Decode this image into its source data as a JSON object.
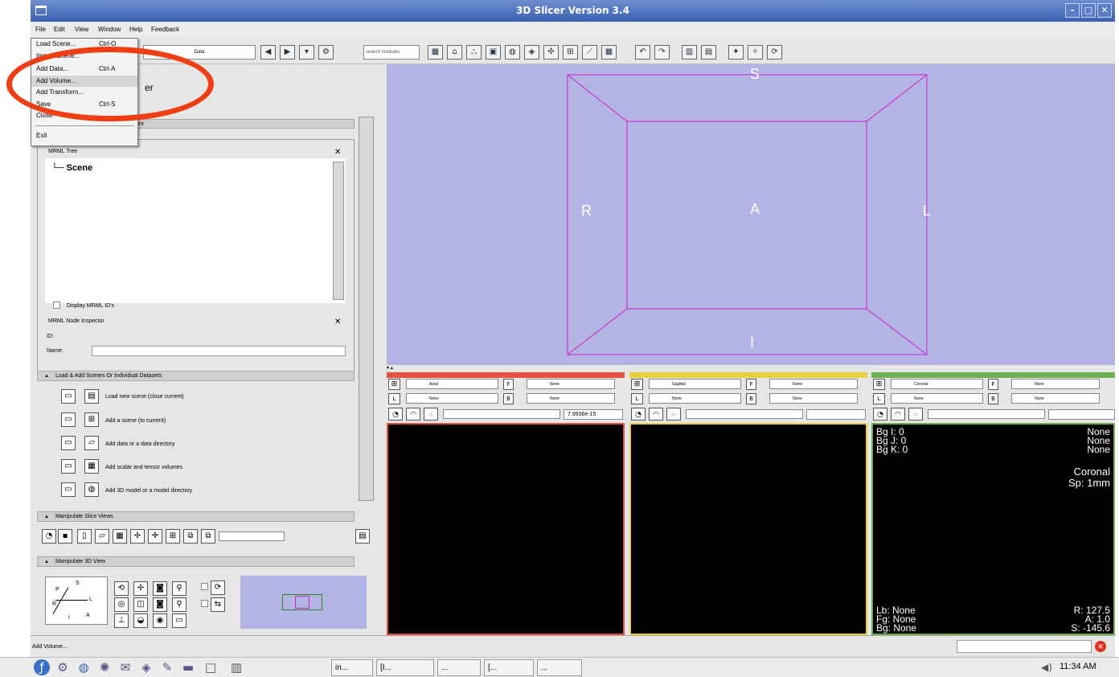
{
  "window": {
    "title": "3D Slicer Version 3.4"
  },
  "menubar": {
    "file": "File",
    "edit": "Edit",
    "view": "View",
    "window": "Window",
    "help": "Help",
    "feedback": "Feedback"
  },
  "file_menu": {
    "items": [
      {
        "label": "Load Scene...",
        "shortcut": "Ctrl-O"
      },
      {
        "label": "Import Scene...",
        "shortcut": ""
      },
      {
        "label": "Add Data...",
        "shortcut": "Ctrl-A"
      },
      {
        "label": "Add Volume...",
        "shortcut": ""
      },
      {
        "label": "Add Transform...",
        "shortcut": ""
      },
      {
        "label": "Save",
        "shortcut": "Ctrl-S"
      },
      {
        "label": "Close",
        "shortcut": ""
      },
      {
        "label": "Exit",
        "shortcut": ""
      }
    ],
    "highlighted": "Add Volume..."
  },
  "toolbar": {
    "module_select": "Data",
    "search_placeholder": "search modules"
  },
  "left_panel": {
    "title_fragment": "er",
    "section_fragment": "ent",
    "mrml_tree": {
      "label": "MRML Tree",
      "root": "Scene",
      "display_ids": "Display MRML ID's"
    },
    "node_inspector": {
      "label": "MRML Node Inspector",
      "id_label": "ID:",
      "name_label": "Name:"
    },
    "load_section": {
      "title": "Load & Add Scenes Or Individual Datasets",
      "items": [
        "Load new scene (close current)",
        "Add a scene (to current)",
        "Add data or a data directory",
        "Add scalar and tensor volumes",
        "Add 3D model or a model directory"
      ]
    },
    "slice_views_section": {
      "title": "Manipulate Slice Views"
    },
    "view3d_section": {
      "title": "Manipulate 3D View",
      "axes": {
        "S": "S",
        "L": "L",
        "P": "P",
        "R": "R",
        "I": "I",
        "A": "A"
      }
    }
  },
  "view3d": {
    "labels": {
      "top": "S",
      "bottom": "I",
      "left": "R",
      "right": "L",
      "center": "A"
    },
    "background": "#b3b3e4",
    "box_color": "#d020d0"
  },
  "slices": [
    {
      "name": "Axial",
      "color": "#e85040",
      "fg": "None",
      "bg": "None",
      "label": "None",
      "offset": "7.9936e-15"
    },
    {
      "name": "Sagittal",
      "color": "#e8d040",
      "fg": "None",
      "bg": "None",
      "label": "None",
      "offset": ""
    },
    {
      "name": "Coronal",
      "color": "#6cb050",
      "fg": "None",
      "bg": "None",
      "label": "None",
      "offset": ""
    }
  ],
  "coronal_overlay": {
    "top_left": "Bg I: 0\nBg J: 0\nBg K: 0",
    "top_right": "None\nNone\nNone",
    "mid_right": "Coronal\nSp: 1mm",
    "bottom_left": "Lb: None\nFg: None\nBg: None",
    "bottom_right": "R: 127.5\nA: 1.0\nS: -145.6"
  },
  "statusbar": {
    "text": "Add Volume..."
  },
  "taskbar": {
    "buttons": [
      "in...",
      "[I...",
      "...",
      "[...",
      "..."
    ],
    "clock": "11:34 AM"
  },
  "colors": {
    "highlight_ring": "#f23d13",
    "titlebar": "#3a5fb0"
  }
}
